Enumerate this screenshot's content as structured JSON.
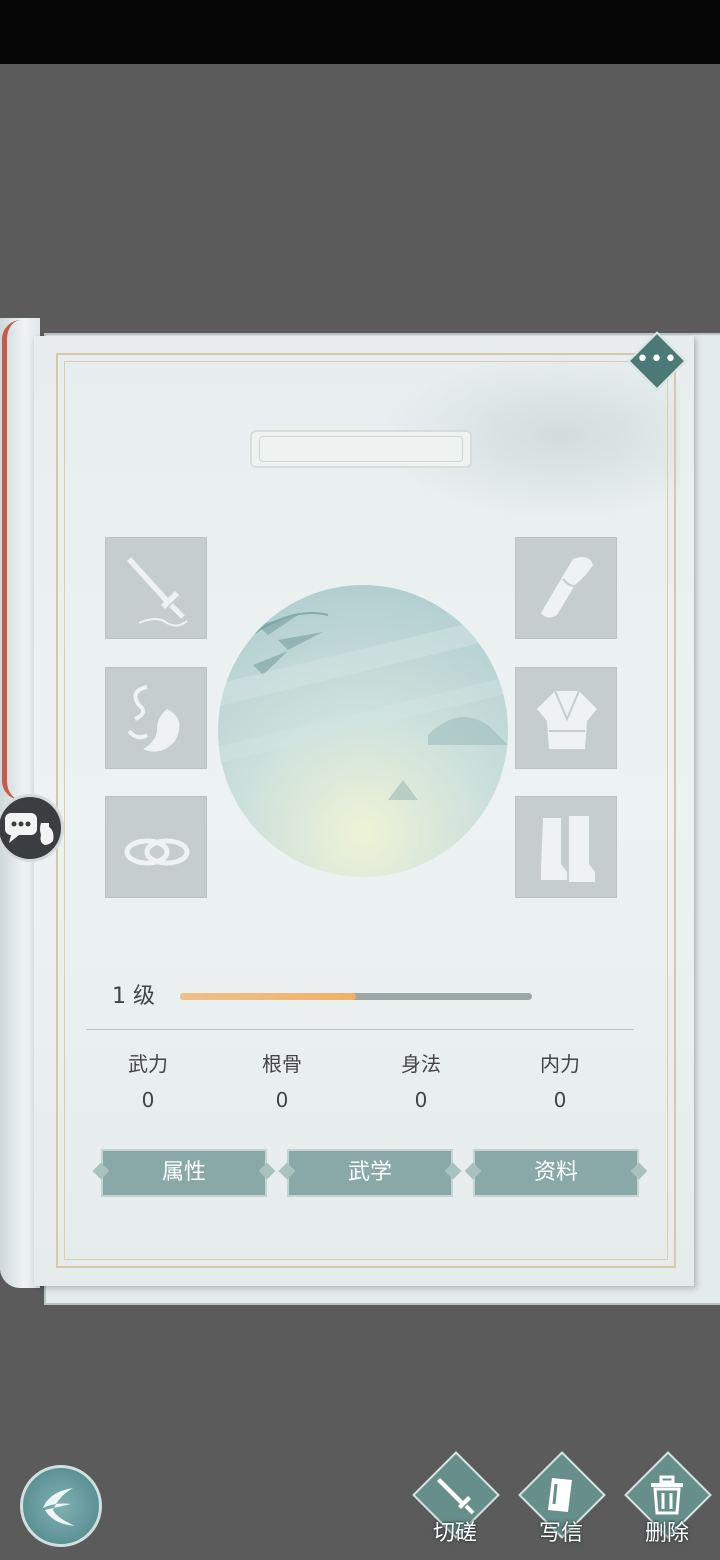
{
  "profile": {
    "character_name": "",
    "level": {
      "label": "1 级",
      "progress": 0.5
    },
    "stats": [
      {
        "name": "武力",
        "value": "0"
      },
      {
        "name": "根骨",
        "value": "0"
      },
      {
        "name": "身法",
        "value": "0"
      },
      {
        "name": "内力",
        "value": "0"
      }
    ],
    "tabs": [
      "属性",
      "武学",
      "资料"
    ],
    "equipment_slots_left": [
      "sword-icon",
      "ribbon-icon",
      "rings-icon"
    ],
    "equipment_slots_right": [
      "bracer-icon",
      "robe-icon",
      "boots-icon"
    ]
  },
  "bottom_actions": [
    {
      "label": "切磋",
      "icon": "sword-icon"
    },
    {
      "label": "写信",
      "icon": "letter-icon"
    },
    {
      "label": "删除",
      "icon": "trash-icon"
    }
  ],
  "colors": {
    "accent": "#4c7a76",
    "exp_bar": "#f2b068",
    "tab_bg": "#88a9a7",
    "ribbon": "#c55c4a"
  }
}
